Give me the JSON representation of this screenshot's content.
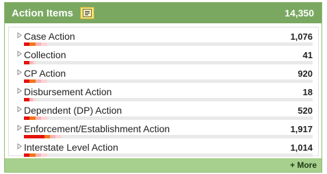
{
  "header": {
    "title": "Action Items",
    "total": "14,350",
    "list_icon": "list-icon"
  },
  "rows": [
    {
      "label": "Case Action",
      "count": "1,076",
      "bar": [
        0.02,
        0.02,
        0.02,
        0.02
      ]
    },
    {
      "label": "Collection",
      "count": "41",
      "bar": [
        0.02,
        0,
        0.01,
        0.01
      ]
    },
    {
      "label": "CP Action",
      "count": "920",
      "bar": [
        0.02,
        0.02,
        0.02,
        0.02
      ]
    },
    {
      "label": "Disbursement Action",
      "count": "18",
      "bar": [
        0.02,
        0,
        0.01,
        0.01
      ]
    },
    {
      "label": "Dependent (DP) Action",
      "count": "520",
      "bar": [
        0.02,
        0.02,
        0.02,
        0.02
      ]
    },
    {
      "label": "Enforcement/Establishment Action",
      "count": "1,917",
      "bar": [
        0.07,
        0.02,
        0.02,
        0.02
      ]
    },
    {
      "label": "Interstate Level Action",
      "count": "1,014",
      "bar": [
        0.02,
        0.02,
        0.02,
        0.02
      ]
    }
  ],
  "bar_colors": [
    "#e4120c",
    "#f3761a",
    "#f5b5b8",
    "#fbd3d6"
  ],
  "footer": {
    "more": "+ More"
  }
}
